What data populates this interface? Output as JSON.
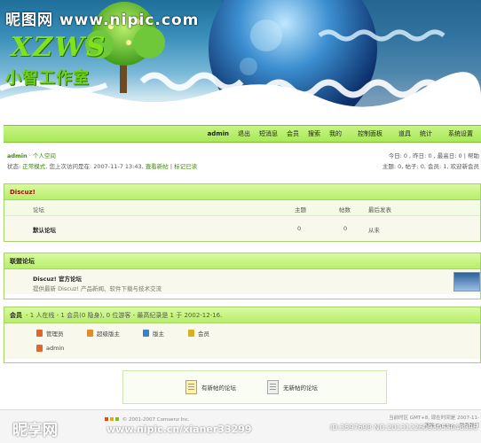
{
  "watermark": {
    "top": "昵图网 www.nipic.com",
    "bottom_brand": "昵享网",
    "bottom_url": "www.nipic.cn",
    "bottom_user": "xianer33299",
    "bottom_id": "ID:3597698 NO:20131226093053048396"
  },
  "logo": {
    "en": "XZWS",
    "cn": "小智工作室"
  },
  "nav": {
    "items": [
      "admin",
      "退出",
      "短消息",
      "会员",
      "搜索",
      "我的",
      "控制面板",
      "道具",
      "统计",
      "系统设置"
    ]
  },
  "user_info": {
    "username": "admin",
    "space": "· 个人空间",
    "status_label": "状态:",
    "status_mode": "正常模式,",
    "last_visit": "您上次访问是在: 2007-11-7 13:43,",
    "view_new": "查看新帖",
    "mark_read": "标记已读",
    "stats_line1": "今日: 0 , 昨日: 0 , 最高日: 0 | 帮助",
    "stats_line2": "主题: 0, 帖子: 0, 会员: 1, 欢迎新会员"
  },
  "forum_box": {
    "title": "Discuz!",
    "col_forum": "论坛",
    "col_topics": "主题",
    "col_posts": "帖数",
    "col_last": "最后发表",
    "row_name": "默认论坛",
    "row_topics": "0",
    "row_posts": "0",
    "row_last": "从未"
  },
  "league_box": {
    "title": "联盟论坛",
    "name": "Discuz! 官方论坛",
    "desc": "提供最新 Discuz! 产品新闻、软件下载与技术交流"
  },
  "members_box": {
    "title": "会员",
    "summary": "- 1 人在线 - 1 会员(0 隐身), 0 位游客 - 最高纪录是 1 于 2002-12-16.",
    "groups": [
      {
        "label": "管理员",
        "color": "#e0662a"
      },
      {
        "label": "超级版主",
        "color": "#e08c2a"
      },
      {
        "label": "版主",
        "color": "#3a80c9"
      },
      {
        "label": "会员",
        "color": "#d6b21e"
      }
    ],
    "online_user": "admin"
  },
  "legend": {
    "new": "有新帖的论坛",
    "none": "无新帖的论坛"
  },
  "footer": {
    "copyright": "© 2001-2007 Comsenz Inc.",
    "timezone": "当前时区 GMT+8, 现在时间是 2007-11-",
    "timezone2": "清除 Cookies - 联系我们"
  }
}
